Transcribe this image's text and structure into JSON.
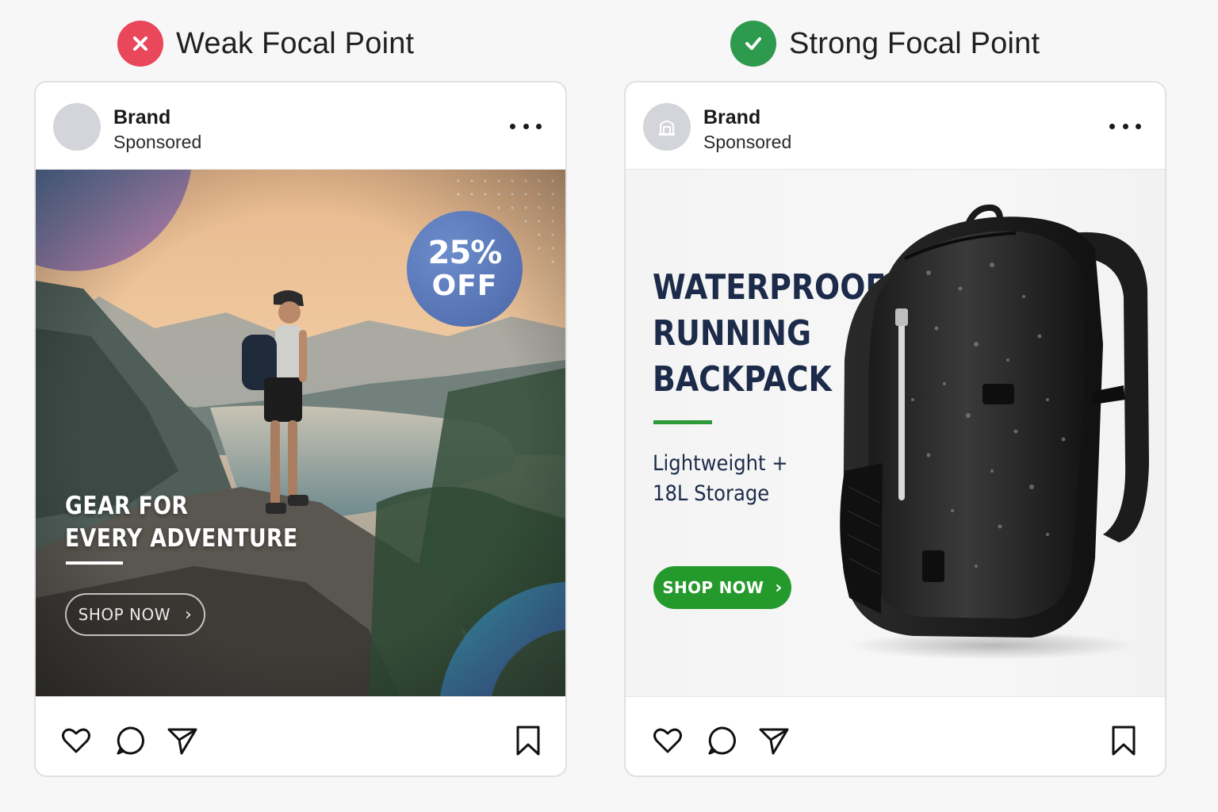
{
  "comparison": {
    "weak": {
      "heading": "Weak Focal Point",
      "badge_icon": "x-icon",
      "badge_color": "#e9475a"
    },
    "strong": {
      "heading": "Strong Focal Point",
      "badge_icon": "check-icon",
      "badge_color": "#2e9a4d"
    }
  },
  "weak_ad": {
    "brand": "Brand",
    "sponsored": "Sponsored",
    "discount_line1": "25%",
    "discount_line2": "OFF",
    "headline_line1": "GEAR FOR",
    "headline_line2": "EVERY ADVENTURE",
    "cta": "SHOP NOW",
    "cta_icon": "chevron-right-icon",
    "actions": [
      "heart-icon",
      "comment-icon",
      "send-icon",
      "bookmark-icon"
    ]
  },
  "strong_ad": {
    "brand": "Brand",
    "sponsored": "Sponsored",
    "headline_line1": "WATERPROOF",
    "headline_line2": "RUNNING",
    "headline_line3": "BACKPACK",
    "sub_line1": "Lightweight +",
    "sub_line2": "18L Storage",
    "cta": "SHOP NOW",
    "cta_icon": "chevron-right-icon",
    "accent_color": "#249a2c",
    "headline_color": "#1d2b4a",
    "actions": [
      "heart-icon",
      "comment-icon",
      "send-icon",
      "bookmark-icon"
    ]
  }
}
